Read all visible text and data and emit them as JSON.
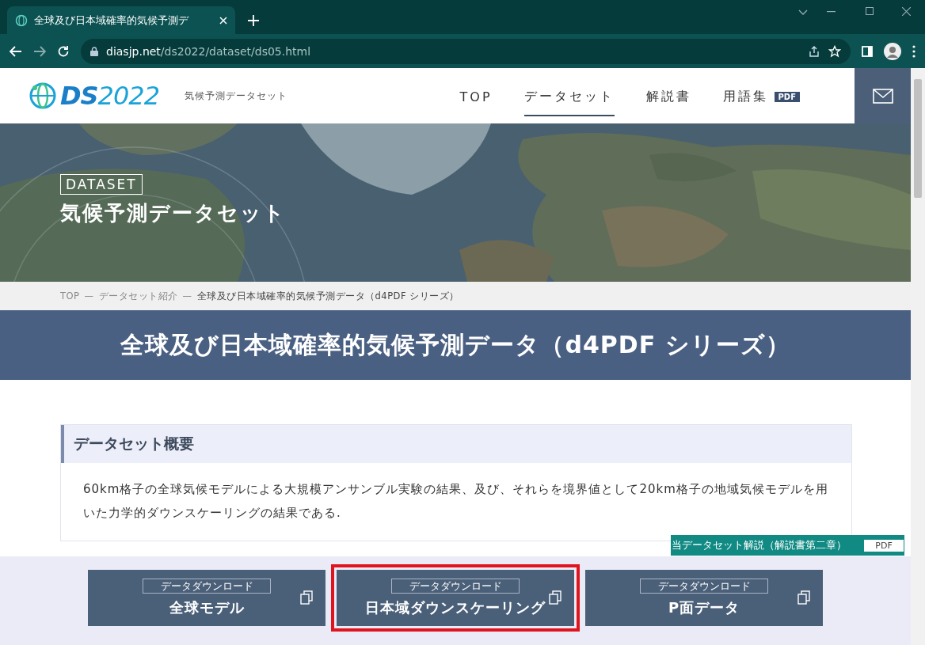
{
  "browser": {
    "tab_title": "全球及び日本域確率的気候予測デ",
    "url_host": "diasjp.net",
    "url_path": "/ds2022/dataset/ds05.html"
  },
  "header": {
    "logo": "**DS**2022",
    "subtitle": "気候予測データセット",
    "nav": [
      {
        "label": "TOP",
        "selected": false
      },
      {
        "label": "データセット",
        "selected": true
      },
      {
        "label": "解説書",
        "selected": false
      },
      {
        "label": "用語集",
        "selected": false,
        "badge": "PDF"
      }
    ]
  },
  "hero": {
    "kind": "picture",
    "label": "DATASET",
    "title": "気候予測データセット"
  },
  "breadcrumb": [
    {
      "kind": "link",
      "text": "TOP"
    },
    {
      "kind": "separator",
      "text": "—"
    },
    {
      "kind": "link",
      "text": "データセット紹介"
    },
    {
      "kind": "separator",
      "text": "—"
    },
    {
      "kind": "current",
      "text": "全球及び日本域確率的気候予測データ（d4PDF シリーズ）"
    }
  ],
  "page_title": "全球及び日本域確率的気候予測データ（d4PDF シリーズ）",
  "overview": {
    "heading": "データセット概要",
    "body": "60km格子の全球気候モデルによる大規模アンサンブル実験の結果、及び、それらを境界値として20km格子の地域気候モデルを用いた力学的ダウンスケーリングの結果である."
  },
  "manual_link": {
    "label": "当データセット解説（解説書第二章）",
    "badge": "PDF"
  },
  "downloads": [
    {
      "caption": "データダウンロード",
      "label": "全球モデル",
      "highlighted": false
    },
    {
      "caption": "データダウンロード",
      "label": "日本域ダウンスケーリング",
      "highlighted": true
    },
    {
      "caption": "データダウンロード",
      "label": "P面データ",
      "highlighted": false
    }
  ]
}
